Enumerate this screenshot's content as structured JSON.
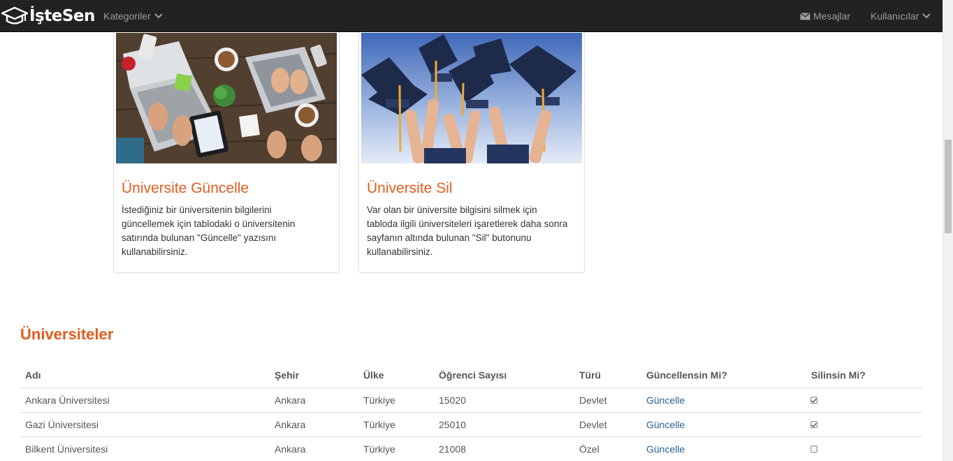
{
  "navbar": {
    "brand": "İşteSen",
    "categories_label": "Kategoriler",
    "messages_label": "Mesajlar",
    "users_label": "Kullanıcılar"
  },
  "cards": [
    {
      "title": "Üniversite Güncelle",
      "text": "İstediğiniz bir üniversitenin bilgilerini güncellemek için tablodaki o üniversitenin satırında bulunan \"Güncelle\" yazısını kullanabilirsiniz."
    },
    {
      "title": "Üniversite Sil",
      "text": "Var olan bir üniversite bilgisini silmek için tabloda ilgili üniversiteleri işaretlerek daha sonra sayfanın altında bulunan \"Sil\" butonunu kullanabilirsiniz."
    }
  ],
  "section_title": "Üniversiteler",
  "table": {
    "headers": [
      "Adı",
      "Şehir",
      "Ülke",
      "Öğrenci Sayısı",
      "Türü",
      "Güncellensin Mi?",
      "Silinsin Mi?"
    ],
    "rows": [
      {
        "name": "Ankara Üniversitesi",
        "city": "Ankara",
        "country": "Türkiye",
        "students": "15020",
        "type": "Devlet",
        "update_link": "Güncelle",
        "delete_checked": true
      },
      {
        "name": "Gazi Üniversitesi",
        "city": "Ankara",
        "country": "Türkiye",
        "students": "25010",
        "type": "Devlet",
        "update_link": "Güncelle",
        "delete_checked": true
      },
      {
        "name": "Bilkent Üniversitesi",
        "city": "Ankara",
        "country": "Türkiye",
        "students": "21008",
        "type": "Özel",
        "update_link": "Güncelle",
        "delete_checked": false
      }
    ]
  },
  "colors": {
    "accent": "#e25c1f",
    "link": "#2a6496",
    "navbar_bg": "#222222"
  }
}
